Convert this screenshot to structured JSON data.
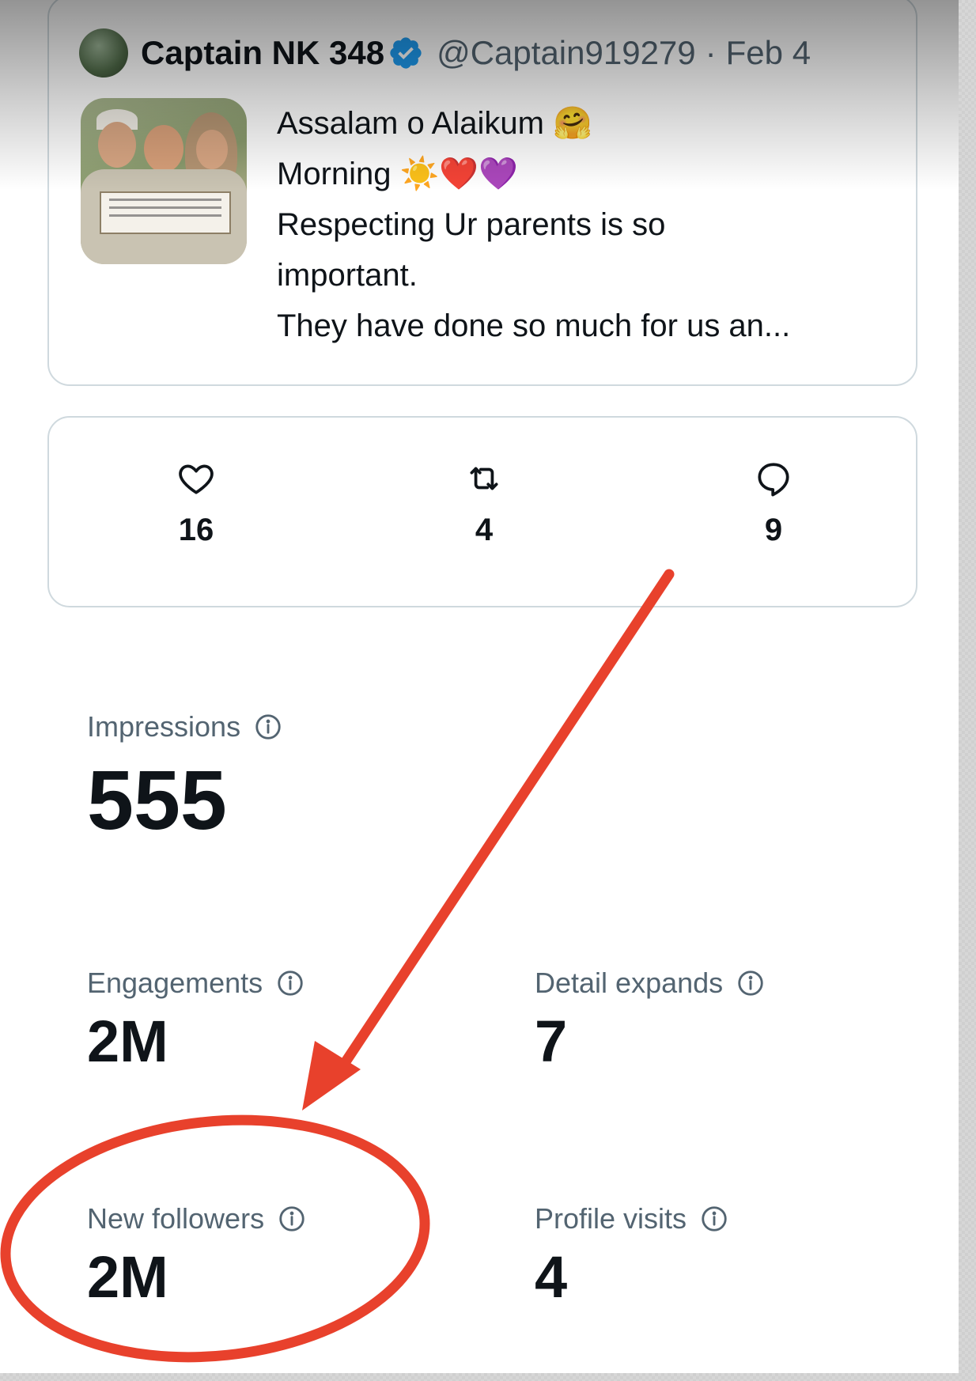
{
  "tweet": {
    "author_name": "Captain NK 348",
    "handle": "@Captain919279",
    "separator": "·",
    "date": "Feb 4",
    "text_lines": [
      "Assalam o Alaikum 🤗",
      "Morning ☀️❤️💜",
      "Respecting Ur parents is so",
      "important.",
      "They have done so much for us an..."
    ]
  },
  "actions": {
    "likes": "16",
    "retweets": "4",
    "replies": "9"
  },
  "metrics": {
    "impressions": {
      "label": "Impressions",
      "value": "555"
    },
    "engagements": {
      "label": "Engagements",
      "value": "2M"
    },
    "detail_expands": {
      "label": "Detail expands",
      "value": "7"
    },
    "new_followers": {
      "label": "New followers",
      "value": "2M"
    },
    "profile_visits": {
      "label": "Profile visits",
      "value": "4"
    }
  },
  "icons": {
    "like": "heart-icon",
    "retweet": "retweet-icon",
    "reply": "reply-icon",
    "info": "info-icon",
    "verified": "verified-badge-icon"
  },
  "colors": {
    "annotation": "#e8412c",
    "verified": "#1d9bf0",
    "muted_text": "#536471",
    "border": "#cfd9de"
  }
}
